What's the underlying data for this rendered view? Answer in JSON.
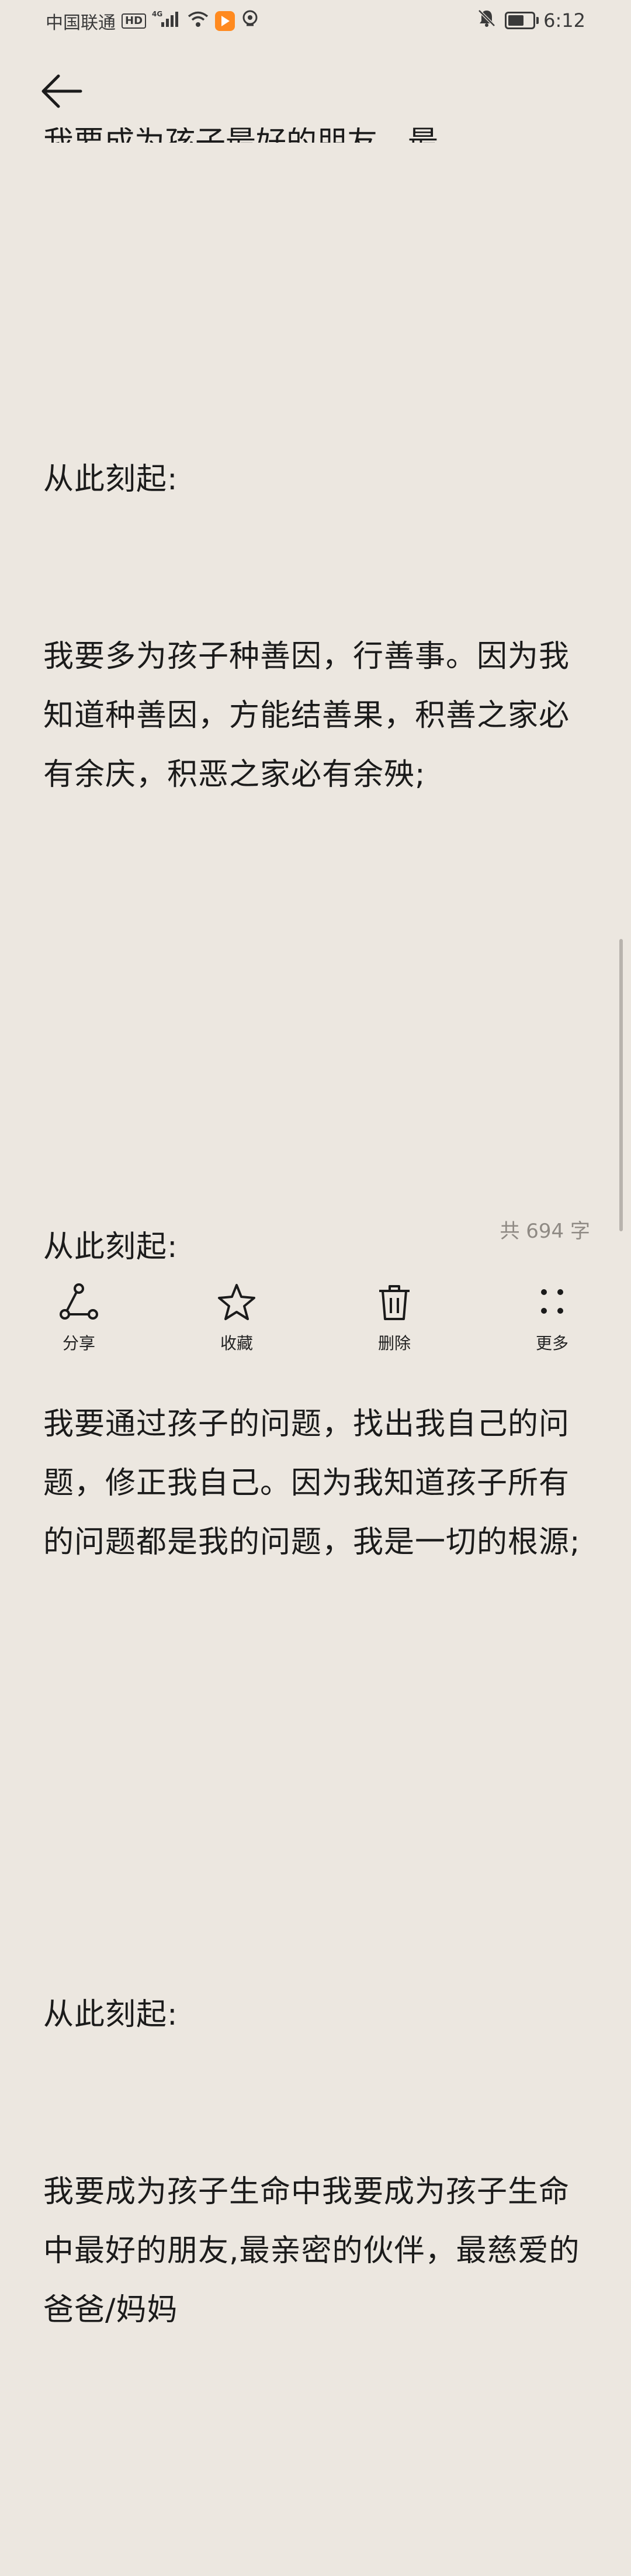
{
  "status_bar": {
    "carrier": "中国联通",
    "hd": "HD",
    "network": "4G",
    "time": "6:12"
  },
  "header": {
    "back_icon": "arrow-left-icon"
  },
  "note": {
    "cutoff_line": "我要成为孩子最好的朋友，最亲密的伙伴；",
    "blocks": [
      {
        "heading": "从此刻起:",
        "text": "我要多为孩子种善因，行善事。因为我知道种善因，方能结善果，积善之家必有余庆，积恶之家必有余殃;"
      },
      {
        "heading": "从此刻起:",
        "text": "我要通过孩子的问题，找出我自己的问题，修正我自己。因为我知道孩子所有的问题都是我的问题，我是一切的根源;"
      },
      {
        "heading": "从此刻起:",
        "text": "我要成为孩子生命中我要成为孩子生命中最好的朋友,最亲密的伙伴，最慈爱的爸爸/妈妈"
      }
    ],
    "word_count": "共 694 字"
  },
  "toolbar": {
    "share_label": "分享",
    "favorite_label": "收藏",
    "delete_label": "删除",
    "more_label": "更多"
  }
}
